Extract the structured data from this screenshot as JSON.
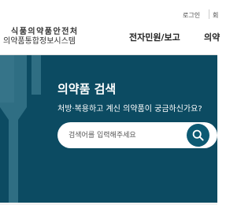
{
  "header": {
    "logo_line1": "식품의약품안전처",
    "logo_line2": "의약품통합정보시스템",
    "util_login": "로그인",
    "util_next": "회",
    "nav": [
      "전자민원/보고",
      "의약"
    ]
  },
  "hero": {
    "title": "의약품 검색",
    "subtitle": "처방·복용하고 계신 의약품이 궁금하신가요?",
    "search_placeholder": "검색어를 입력해주세요"
  },
  "colors": {
    "hero_bg": "#0c4b62",
    "search_button": "#0d5a73"
  }
}
